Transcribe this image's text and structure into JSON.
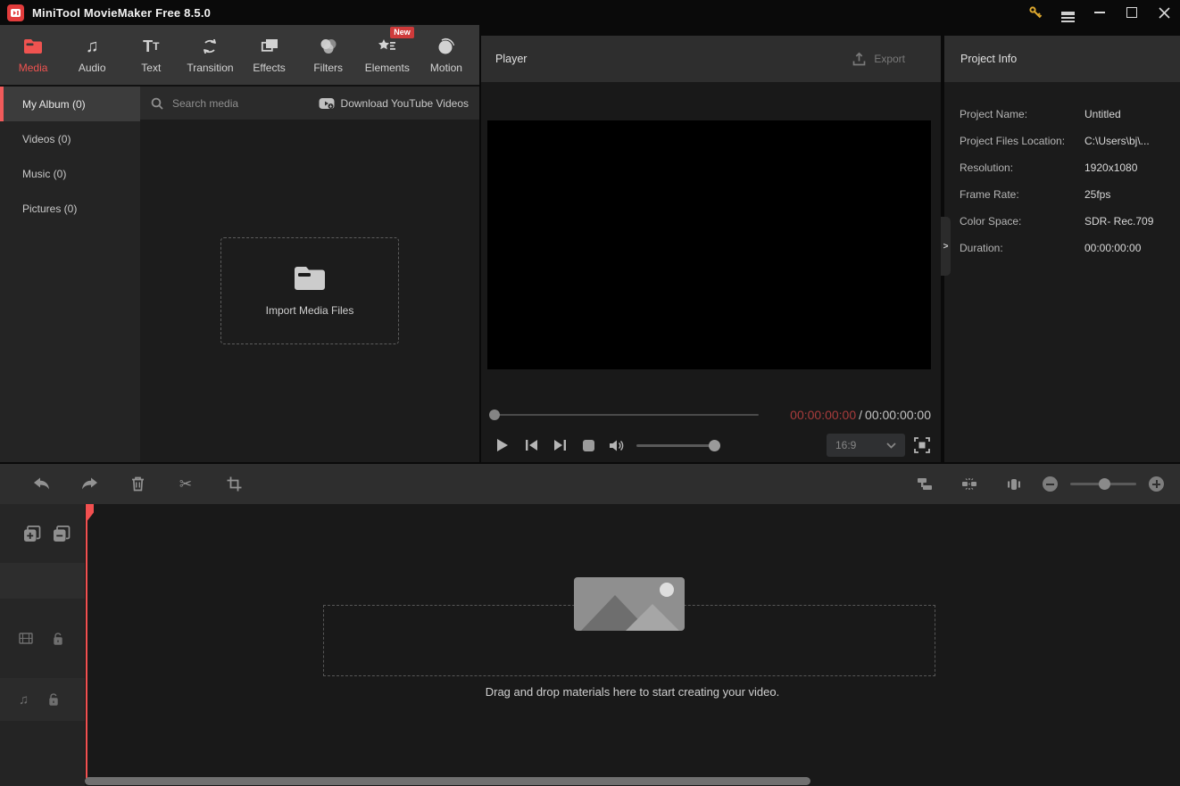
{
  "window": {
    "title": "MiniTool MovieMaker Free 8.5.0"
  },
  "ribbon": {
    "tabs": [
      {
        "label": "Media",
        "icon": "folder-icon",
        "active": true
      },
      {
        "label": "Audio",
        "icon": "music-note-icon"
      },
      {
        "label": "Text",
        "icon": "text-icon"
      },
      {
        "label": "Transition",
        "icon": "transition-icon"
      },
      {
        "label": "Effects",
        "icon": "effects-icon"
      },
      {
        "label": "Filters",
        "icon": "filters-icon"
      },
      {
        "label": "Elements",
        "icon": "elements-icon",
        "badge": "New"
      },
      {
        "label": "Motion",
        "icon": "motion-icon"
      }
    ]
  },
  "library": {
    "sidebar": [
      {
        "label": "My Album (0)",
        "active": true
      },
      {
        "label": "Videos (0)"
      },
      {
        "label": "Music (0)"
      },
      {
        "label": "Pictures (0)"
      }
    ],
    "search_placeholder": "Search media",
    "youtube_label": "Download YouTube Videos",
    "import_label": "Import Media Files"
  },
  "player": {
    "title": "Player",
    "export_label": "Export",
    "current_time": "00:00:00:00",
    "time_separator": "/",
    "total_time": "00:00:00:00",
    "aspect_ratio": "16:9",
    "controls": [
      "play",
      "previous-frame",
      "next-frame",
      "stop",
      "volume",
      "aspect-ratio-select",
      "fit-screen"
    ]
  },
  "project_info": {
    "title": "Project Info",
    "rows": [
      {
        "label": "Project Name:",
        "value": "Untitled"
      },
      {
        "label": "Project Files Location:",
        "value": "C:\\Users\\bj\\..."
      },
      {
        "label": "Resolution:",
        "value": "1920x1080"
      },
      {
        "label": "Frame Rate:",
        "value": "25fps"
      },
      {
        "label": "Color Space:",
        "value": "SDR- Rec.709"
      },
      {
        "label": "Duration:",
        "value": "00:00:00:00"
      }
    ],
    "collapse_chevron": ">"
  },
  "timeline_toolbar": {
    "edit_tools": [
      "undo",
      "redo",
      "delete",
      "split",
      "crop"
    ],
    "view_tools": [
      "track-manage",
      "split-marker",
      "fit-timeline",
      "zoom-out",
      "zoom-slider",
      "zoom-in"
    ]
  },
  "timeline": {
    "hint": "Drag and drop materials here to start creating your video.",
    "tracks": [
      "video-track",
      "audio-track"
    ]
  },
  "colors": {
    "accent_red": "#ef5350",
    "playhead_red": "#f25050",
    "timecode_red": "#a83c3c",
    "key_yellow": "#dfa92e",
    "badge_red": "#cf3a3a"
  }
}
